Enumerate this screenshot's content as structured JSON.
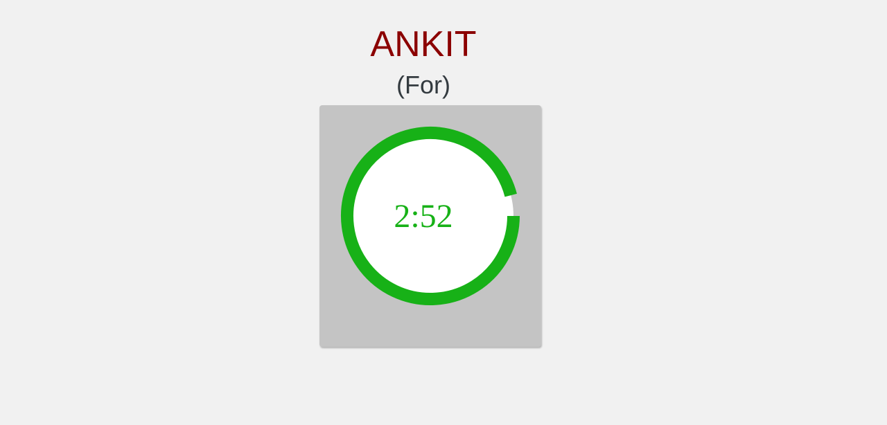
{
  "header": {
    "name": "ANKIT",
    "subtitle": "(For)"
  },
  "timer": {
    "display": "2:52",
    "progress_fraction": 0.96
  },
  "colors": {
    "name": "#8b0000",
    "subtitle": "#333a3f",
    "ring": "#17b117",
    "ring_track": "#ffffff",
    "card": "#c4c4c4",
    "page_bg": "#f1f1f1",
    "timer_text": "#17b117"
  }
}
